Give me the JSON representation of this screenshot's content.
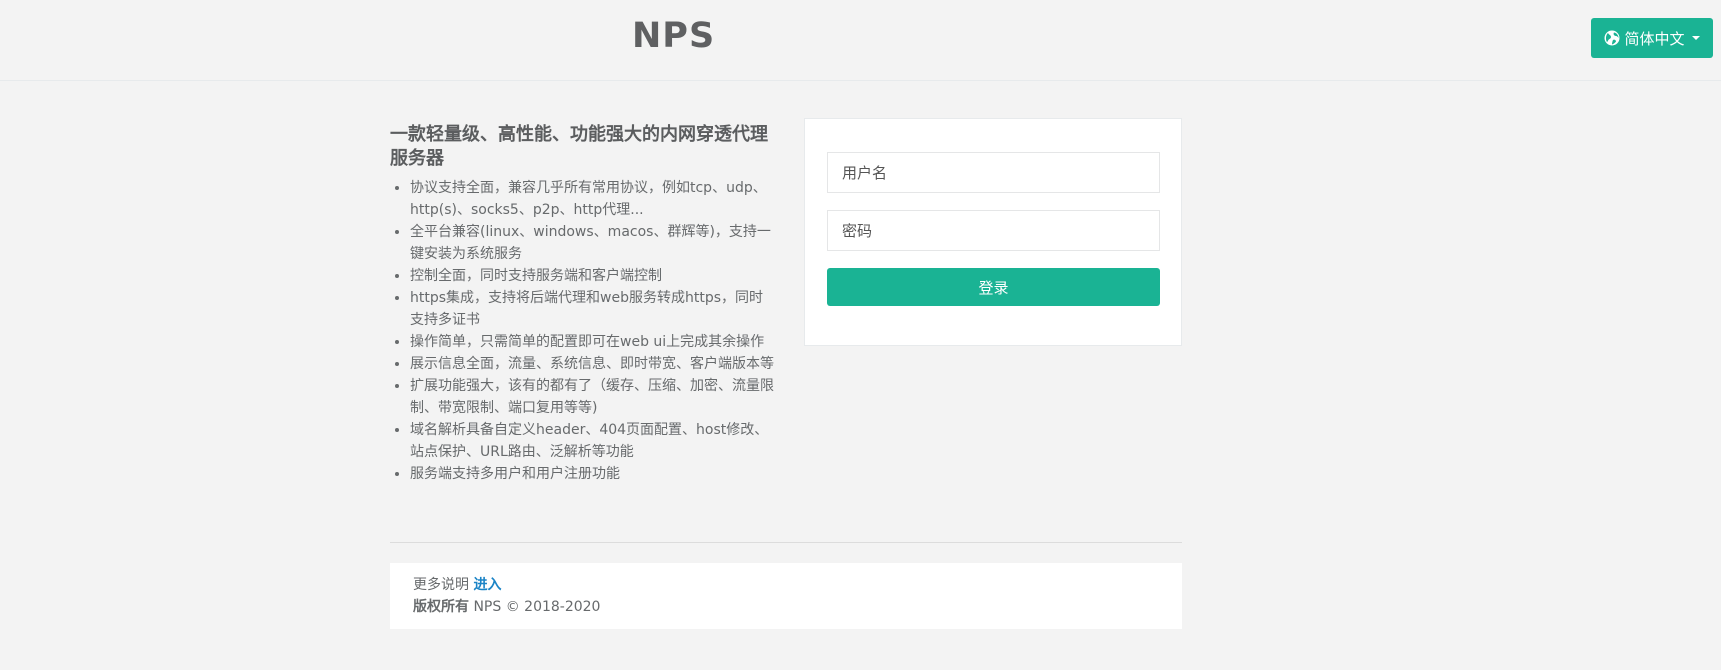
{
  "header": {
    "logo": "NPS",
    "language_button": "简体中文"
  },
  "intro": {
    "title": "一款轻量级、高性能、功能强大的内网穿透代理服务器",
    "features": [
      "协议支持全面，兼容几乎所有常用协议，例如tcp、udp、http(s)、socks5、p2p、http代理...",
      "全平台兼容(linux、windows、macos、群辉等)，支持一键安装为系统服务",
      "控制全面，同时支持服务端和客户端控制",
      "https集成，支持将后端代理和web服务转成https，同时支持多证书",
      "操作简单，只需简单的配置即可在web ui上完成其余操作",
      "展示信息全面，流量、系统信息、即时带宽、客户端版本等",
      "扩展功能强大，该有的都有了（缓存、压缩、加密、流量限制、带宽限制、端口复用等等)",
      "域名解析具备自定义header、404页面配置、host修改、站点保护、URL路由、泛解析等功能",
      "服务端支持多用户和用户注册功能"
    ]
  },
  "login": {
    "username_placeholder": "用户名",
    "password_placeholder": "密码",
    "submit_label": "登录"
  },
  "footer": {
    "more_text": "更多说明",
    "more_link": "进入",
    "copyright_label": "版权所有",
    "copyright_text": "NPS © 2018-2020"
  },
  "colors": {
    "accent": "#1ab394",
    "link": "#1c84c6",
    "background": "#f3f3f3"
  }
}
